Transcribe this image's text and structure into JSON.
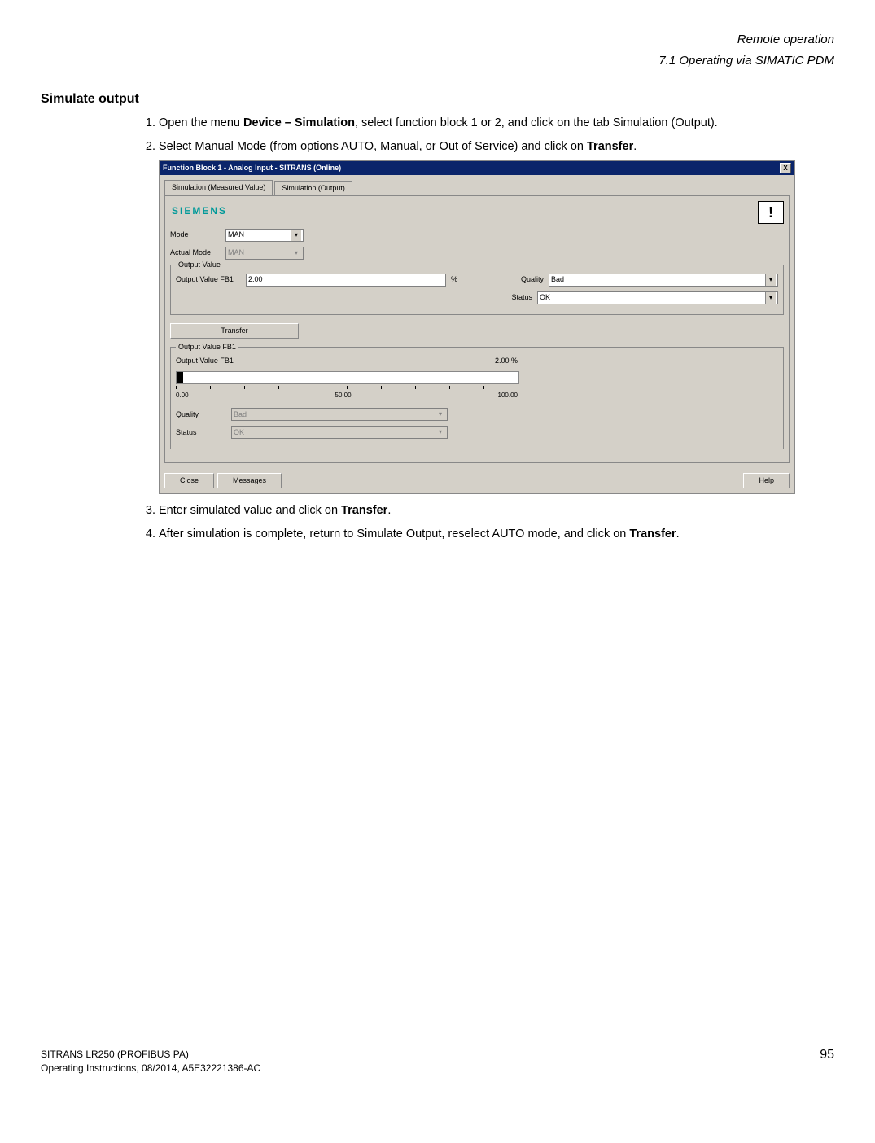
{
  "header": {
    "chapter": "Remote operation",
    "section": "7.1 Operating via SIMATIC PDM"
  },
  "title": "Simulate output",
  "steps": {
    "s1a": "Open the menu ",
    "s1b": "Device – Simulation",
    "s1c": ", select function block 1 or 2, and click on the tab Simulation (Output).",
    "s2a": "Select Manual Mode (from options AUTO, Manual, or Out of Service) and click on ",
    "s2b": "Transfer",
    "s2c": ".",
    "s3a": "Enter simulated value and click on ",
    "s3b": "Transfer",
    "s3c": ".",
    "s4a": "After simulation is complete, return to Simulate Output, reselect AUTO mode, and click on ",
    "s4b": "Transfer",
    "s4c": "."
  },
  "dialog": {
    "title": "Function Block 1 - Analog Input - SITRANS  (Online)",
    "tabs": {
      "measured": "Simulation (Measured Value)",
      "output": "Simulation (Output)"
    },
    "brand": "SIEMENS",
    "warn": "!",
    "labels": {
      "mode": "Mode",
      "actual_mode": "Actual Mode",
      "output_value_group": "Output Value",
      "output_value_fb1": "Output Value FB1",
      "quality": "Quality",
      "status": "Status",
      "output_value_fb1_group": "Output Value FB1",
      "percent": "%"
    },
    "values": {
      "mode": "MAN",
      "actual_mode": "MAN",
      "output_value": "2.00",
      "quality": "Bad",
      "status": "OK",
      "bar_label": "Output Value FB1",
      "bar_value": "2.00 %",
      "scale_min": "0.00",
      "scale_mid": "50.00",
      "scale_max": "100.00",
      "quality_ro": "Bad",
      "status_ro": "OK"
    },
    "buttons": {
      "transfer": "Transfer",
      "close": "Close",
      "messages": "Messages",
      "help": "Help"
    }
  },
  "footer": {
    "product": "SITRANS LR250 (PROFIBUS PA)",
    "doc": "Operating Instructions, 08/2014, A5E32221386-AC",
    "page": "95"
  }
}
